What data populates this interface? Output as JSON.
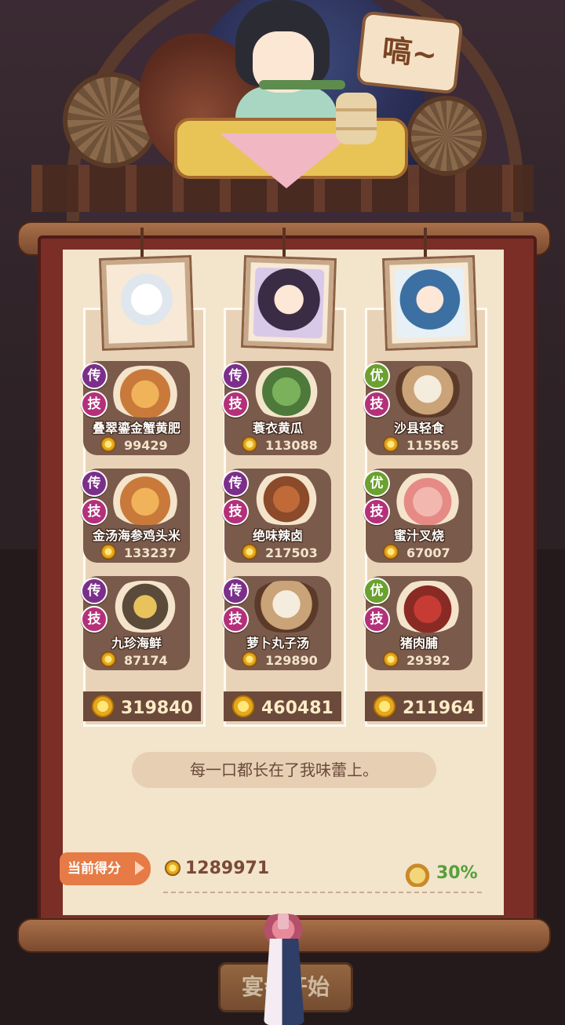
{
  "speech_bubble": "嗃~",
  "columns": [
    {
      "portrait": "guest-1-portrait",
      "dishes": [
        {
          "tier": "传",
          "skill": "技",
          "name": "叠翠鎏金蟹黄肥",
          "score": "99429"
        },
        {
          "tier": "传",
          "skill": "技",
          "name": "金汤海参鸡头米",
          "score": "133237"
        },
        {
          "tier": "传",
          "skill": "技",
          "name": "九珍海鲜",
          "score": "87174"
        }
      ],
      "total": "319840"
    },
    {
      "portrait": "guest-2-portrait",
      "dishes": [
        {
          "tier": "传",
          "skill": "技",
          "name": "蓑衣黄瓜",
          "score": "113088"
        },
        {
          "tier": "传",
          "skill": "技",
          "name": "绝味辣卤",
          "score": "217503"
        },
        {
          "tier": "传",
          "skill": "技",
          "name": "萝卜丸子汤",
          "score": "129890"
        }
      ],
      "total": "460481"
    },
    {
      "portrait": "guest-3-portrait",
      "dishes": [
        {
          "tier": "优",
          "skill": "技",
          "name": "沙县轻食",
          "score": "115565"
        },
        {
          "tier": "优",
          "skill": "技",
          "name": "蜜汁叉烧",
          "score": "67007"
        },
        {
          "tier": "优",
          "skill": "技",
          "name": "猪肉脯",
          "score": "29392"
        }
      ],
      "total": "211964"
    }
  ],
  "quote": "每一口都长在了我味蕾上。",
  "current_score_label": "当前得分",
  "current_score": "1289971",
  "fullness_percent": "30%",
  "start_button": "宴会开始",
  "colors": {
    "legend_badge": "#7b2f8a",
    "good_badge": "#6aa12f",
    "skill_badge": "#b4317a",
    "score_tag": "#e67b46",
    "fullness_green": "#55a03a"
  }
}
